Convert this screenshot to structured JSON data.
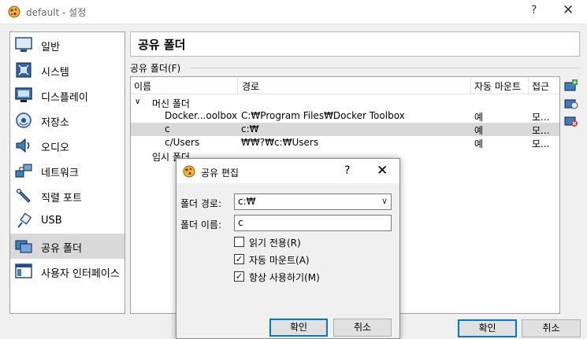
{
  "window": {
    "title": "default - 설정",
    "help": "?",
    "close": "✕"
  },
  "sidebar": {
    "items": [
      {
        "label": "일반",
        "icon": "monitor-icon",
        "selected": false
      },
      {
        "label": "시스템",
        "icon": "chip-icon",
        "selected": false
      },
      {
        "label": "디스플레이",
        "icon": "display-icon",
        "selected": false
      },
      {
        "label": "저장소",
        "icon": "storage-icon",
        "selected": false
      },
      {
        "label": "오디오",
        "icon": "speaker-icon",
        "selected": false
      },
      {
        "label": "네트워크",
        "icon": "network-icon",
        "selected": false
      },
      {
        "label": "직렬 포트",
        "icon": "serial-port-icon",
        "selected": false
      },
      {
        "label": "USB",
        "icon": "usb-icon",
        "selected": false
      },
      {
        "label": "공유 폴더",
        "icon": "shared-folder-icon",
        "selected": true
      },
      {
        "label": "사용자 인터페이스",
        "icon": "user-interface-icon",
        "selected": false
      }
    ]
  },
  "page": {
    "title": "공유 폴더",
    "group_label": "공유 폴더(F)"
  },
  "table": {
    "columns": [
      "이름",
      "경로",
      "자동 마운트",
      "접근"
    ],
    "group_machine": "머신 폴더",
    "group_machine_toggle": "∨",
    "rows": [
      {
        "name": "Docker...oolbox",
        "path": "C:₩Program Files₩Docker Toolbox",
        "auto": "예",
        "access": "모...",
        "selected": false
      },
      {
        "name": "c",
        "path": "c:₩",
        "auto": "예",
        "access": "모...",
        "selected": true
      },
      {
        "name": "c/Users",
        "path": "₩₩?₩c:₩Users",
        "auto": "예",
        "access": "모...",
        "selected": false
      }
    ],
    "group_transient": "임시 폴더"
  },
  "side_buttons": [
    "add-folder-icon",
    "edit-folder-icon",
    "remove-folder-icon"
  ],
  "buttons": {
    "ok": "확인",
    "cancel": "취소"
  },
  "dialog": {
    "title": "공유 편집",
    "help": "?",
    "close": "✕",
    "path_label": "폴더 경로:",
    "path_value": "c:₩",
    "name_label": "폴더 이름:",
    "name_value": "c",
    "readonly_label": "읽기 전용(R)",
    "readonly_checked": false,
    "automount_label": "자동 마운트(A)",
    "automount_checked": true,
    "permanent_label": "항상 사용하기(M)",
    "permanent_checked": true,
    "ok": "확인",
    "cancel": "취소"
  },
  "colors": {
    "selection": "#d9d9d9",
    "accent": "#0078d7",
    "border": "#a0a0a0"
  }
}
